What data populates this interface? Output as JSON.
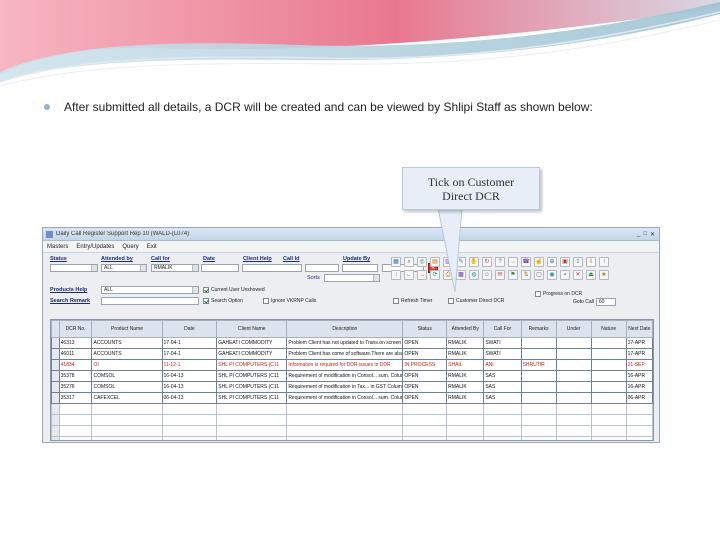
{
  "bullet_text": "After submitted all details, a DCR will be created and can be viewed by Shlipi Staff as shown below:",
  "callout": {
    "line1": "Tick on Customer",
    "line2": "Direct DCR"
  },
  "app": {
    "title": "Daily Call Register   Support Rep 10 (WALD-(L074)",
    "window_buttons": [
      "_",
      "□",
      "✕"
    ],
    "menu": [
      "Masters",
      "Entry/Updates",
      "Query",
      "Exit"
    ],
    "filters": {
      "status_label": "Status",
      "attended_by_label": "Attended by",
      "call_for_label": "Call for",
      "date_label": "Date",
      "client_help_label": "Client Help",
      "call_id_label": "Call Id",
      "update_by_label": "Update By",
      "sorts_label": "Sorts",
      "products_help_label": "Products Help",
      "search_remark_label": "Search Remark",
      "attended_by_value": "ALL",
      "call_for_value": "RMALIK",
      "products_value": "ALL",
      "red_button": "X",
      "cb_current_user": "Current User Unshowed",
      "cb_search_option": "Search Option",
      "cb_ignore_vkrnp": "Ignore VKRNP Calls",
      "cb_refresh_timer": "Refresh Timer",
      "cb_customer_direct": "Customer Direct DCR",
      "progress_label": "Progress on DCR",
      "goto_label": "Goto Call",
      "goto_value": "60"
    },
    "columns": [
      "DCR No.",
      "Product Name",
      "Date",
      "Client Name",
      "Description",
      "Status",
      "Attended By",
      "Call For",
      "Remarks",
      "Under",
      "Nature",
      "Next Date"
    ],
    "rows": [
      {
        "cells": [
          "46313",
          "ACCOUNTS",
          "17-04-1",
          "GAHEATI COMMODITY",
          "Problem Client has not updated to Trans.on screen",
          "OPEN",
          "RMALIK",
          "SWATI",
          "",
          "",
          "",
          "17-APR"
        ],
        "red": false
      },
      {
        "cells": [
          "46011",
          "ACCOUNTS",
          "17-04-1",
          "GAHEATI COMMODITY",
          "Problem Client has come of software.There are also",
          "OPEN",
          "RMALIK",
          "SWATI",
          "",
          "",
          "",
          "17-APR"
        ],
        "red": false
      },
      {
        "cells": [
          "41834",
          "OI",
          "11-12-1",
          "SHL PI COMPUTERS (C11",
          "Information is required for DDR issues in DDR",
          "IN PROCESS",
          "SHAIL",
          "ANI",
          "SHRUTIR",
          "",
          "",
          "21-SEP"
        ],
        "red": true
      },
      {
        "cells": [
          "35378",
          "COMSOL",
          "16-04-13",
          "SHL PI COMPUTERS (C11",
          "Requirement of modification in Consol... sum. Column",
          "OPEN",
          "RMALIK",
          "SAS",
          "",
          "",
          "",
          "16-APR"
        ],
        "red": false
      },
      {
        "cells": [
          "35276",
          "COMSOL",
          "16-04-13",
          "SHL PI COMPUTERS (C11",
          "Requirement of modification in Tax... in GST Column",
          "OPEN",
          "RMALIK",
          "SAS",
          "",
          "",
          "",
          "16-APR"
        ],
        "red": false
      },
      {
        "cells": [
          "35317",
          "CAFEXCEL",
          "06-04-13",
          "SHL PI COMPUTERS (C11",
          "Requirement of modification in Consol... sum. Column",
          "OPEN",
          "RMALIK",
          "SAS",
          "",
          "",
          "",
          "06-APR"
        ],
        "red": false
      }
    ],
    "empty_rows": 5,
    "toolbar_icons": [
      "grid-icon",
      "find-icon",
      "binoculars-icon",
      "notepad-icon",
      "layout-icon",
      "pencil-icon",
      "hand-icon",
      "refresh-icon",
      "help-icon",
      "arrow-right-icon",
      "phone-icon",
      "thumbs-icon",
      "magnify-icon",
      "paste-icon",
      "export-icon",
      "import-icon",
      "upload-icon",
      "down-icon",
      "back-icon",
      "forward-icon",
      "sync-icon",
      "print-icon",
      "excel-icon",
      "web-icon",
      "user-icon",
      "mail-icon",
      "flag-icon",
      "sort-icon",
      "calendar-icon",
      "camera-icon",
      "save-icon",
      "close-icon",
      "exit-icon",
      "star-icon"
    ]
  }
}
